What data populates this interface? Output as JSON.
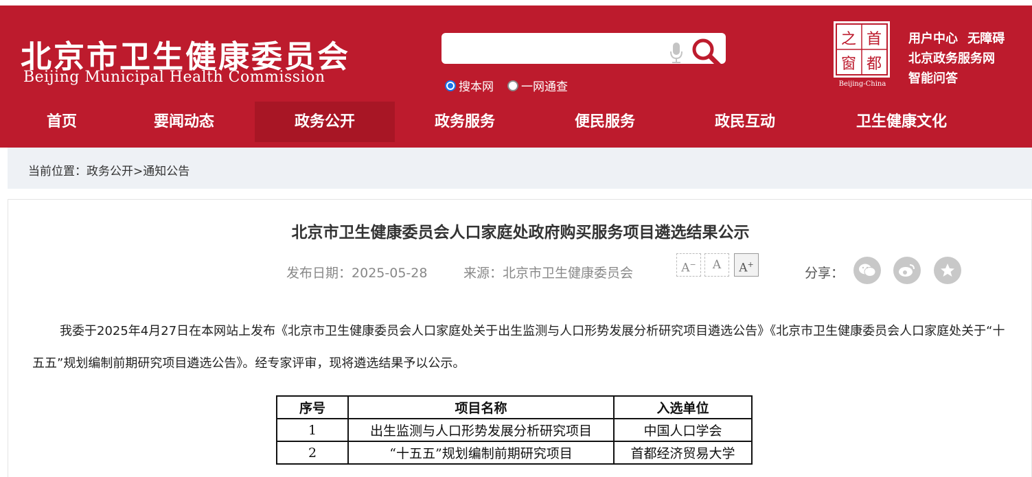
{
  "header": {
    "logo_cn": "北京市卫生健康委员会",
    "logo_en": "Beijing Municipal Health Commission",
    "search": {
      "placeholder": ""
    },
    "search_scopes": [
      {
        "label": "搜本网",
        "checked": true
      },
      {
        "label": "一网通查",
        "checked": false
      }
    ],
    "seal": {
      "chars": [
        "首",
        "之",
        "都",
        "窗"
      ],
      "caption": "Beijing-China"
    },
    "links": {
      "user_center": "用户中心",
      "accessibility": "无障碍",
      "gov_service": "北京政务服务网",
      "qa": "智能问答"
    }
  },
  "nav": {
    "items": [
      "首页",
      "要闻动态",
      "政务公开",
      "政务服务",
      "便民服务",
      "政民互动",
      "卫生健康文化"
    ],
    "active": "政务公开"
  },
  "breadcrumb": {
    "prefix": "当前位置：",
    "section": "政务公开",
    "separator": ">",
    "current": "通知公告"
  },
  "article": {
    "title": "北京市卫生健康委员会人口家庭处政府购买服务项目遴选结果公示",
    "date_label": "发布日期：",
    "date": "2025-05-28",
    "source_label": "来源：",
    "source": "北京市卫生健康委员会",
    "font_sizes": [
      "A-",
      "A",
      "A+"
    ],
    "share_label": "分享：",
    "share_icons": [
      "wechat-icon",
      "weibo-icon",
      "favorite-icon"
    ],
    "paragraph": "我委于2025年4月27日在本网站上发布《北京市卫生健康委员会人口家庭处关于出生监测与人口形势发展分析研究项目遴选公告》《北京市卫生健康委员会人口家庭处关于“十五五”规划编制前期研究项目遴选公告》。经专家评审，现将遴选结果予以公示。",
    "table": {
      "headers": [
        "序号",
        "项目名称",
        "入选单位"
      ],
      "rows": [
        [
          "1",
          "出生监测与人口形势发展分析研究项目",
          "中国人口学会"
        ],
        [
          "2",
          "“十五五”规划编制前期研究项目",
          "首都经济贸易大学"
        ]
      ]
    }
  },
  "colors": {
    "brand_red": "#bd1b2d",
    "nav_active": "#a81625",
    "breadcrumb_bg": "#eef1f5"
  }
}
